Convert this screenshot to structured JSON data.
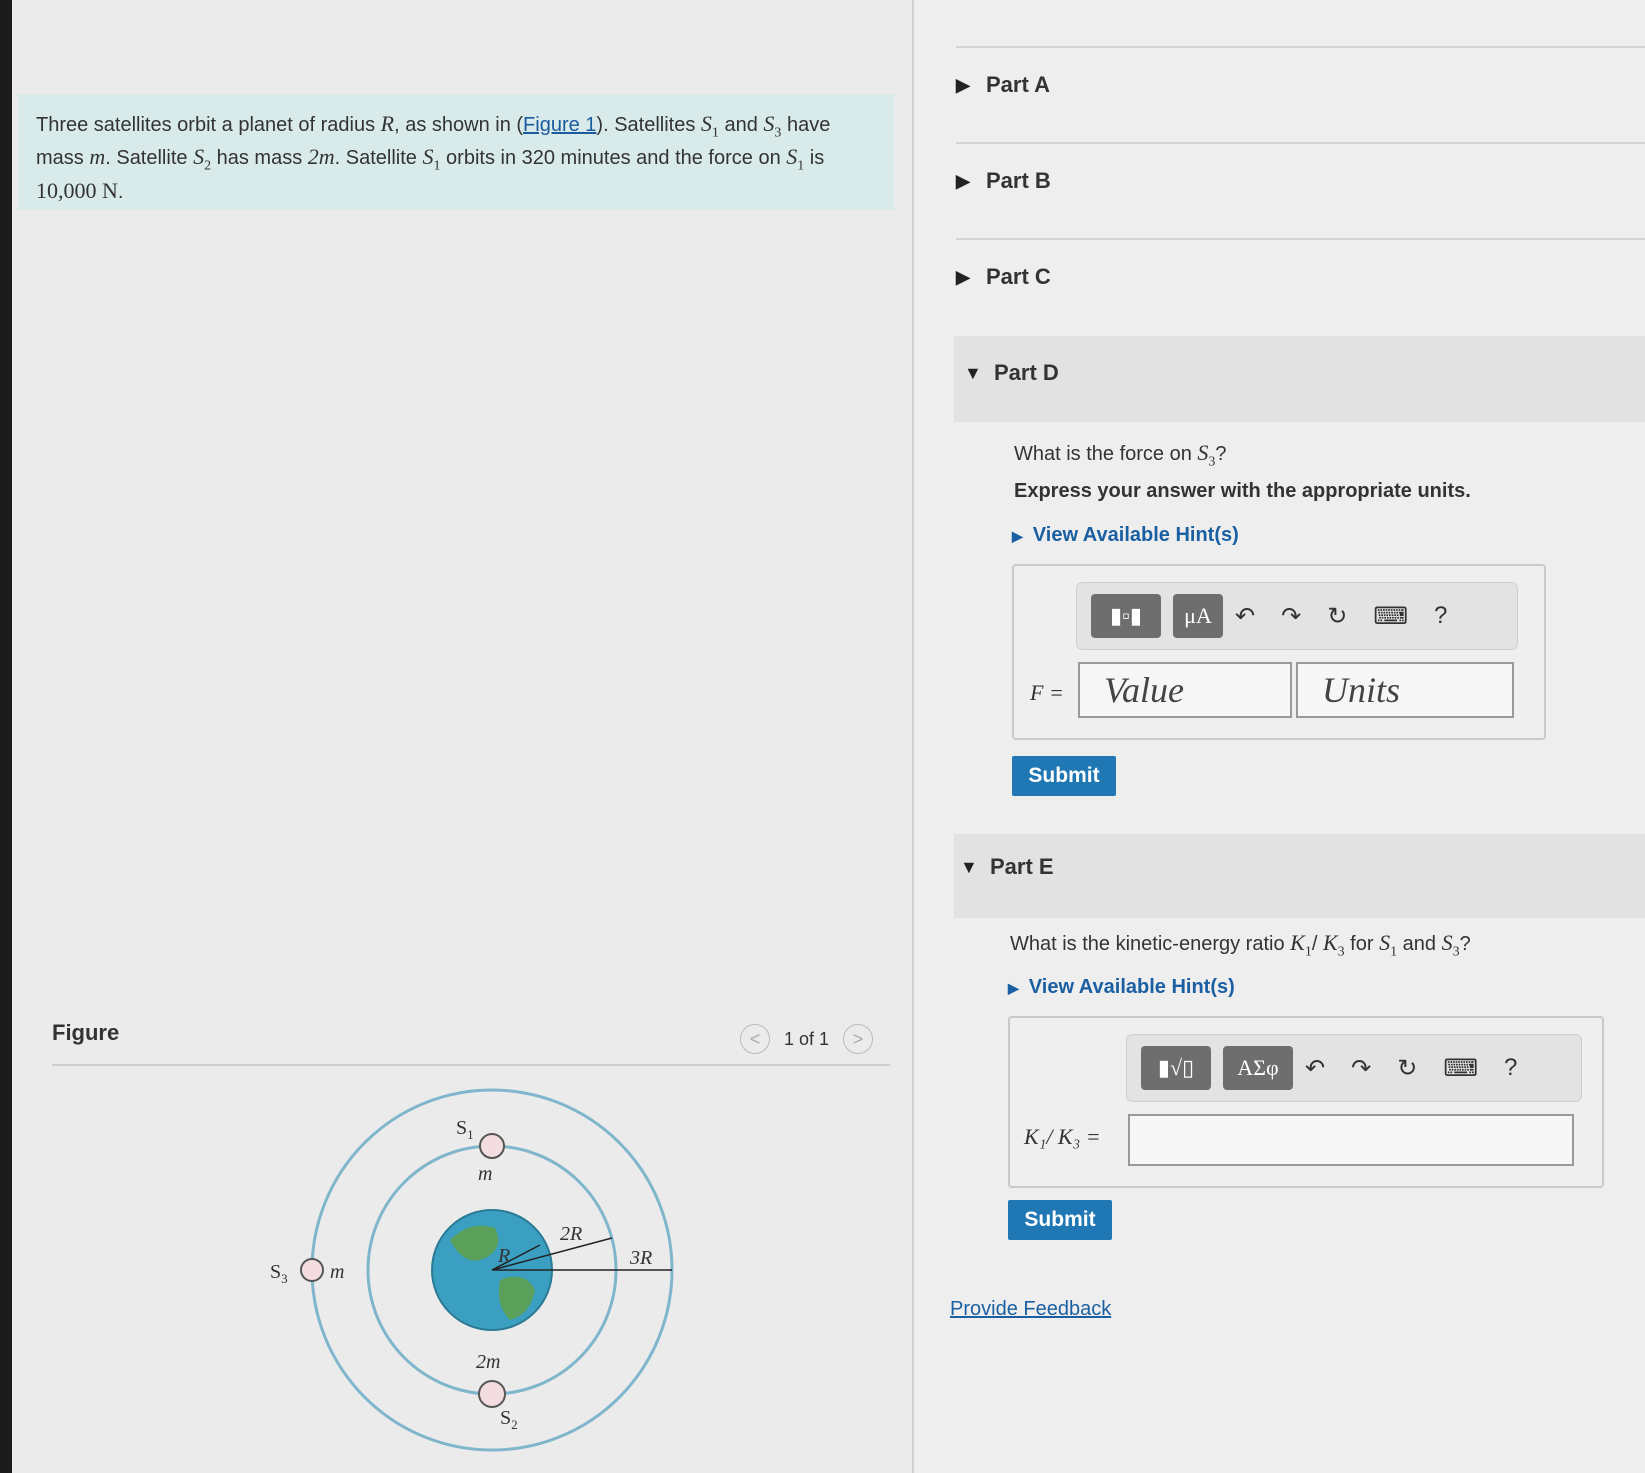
{
  "problem": {
    "t1": "Three satellites orbit a planet of radius ",
    "R": "R",
    "t2": ", as shown in (",
    "figure_link": "Figure 1",
    "t3": "). Satellites ",
    "S1": "S",
    "S1_sub": "1",
    "t4": " and ",
    "S3": "S",
    "S3_sub": "3",
    "t5": " have mass ",
    "m": "m",
    "t6": ". Satellite ",
    "S2": "S",
    "S2_sub": "2",
    "t7": " has mass ",
    "two_m": "2m",
    "t8": ". Satellite ",
    "S1b": "S",
    "S1b_sub": "1",
    "t9": " orbits in 320 minutes and the force on ",
    "S1c": "S",
    "S1c_sub": "1",
    "t10": " is ",
    "force": "10,000 N",
    "t11": "."
  },
  "figure": {
    "label": "Figure",
    "pager_text": "1 of 1",
    "prev": "<",
    "next": ">",
    "labels": {
      "s1": "S",
      "s1_sub": "1",
      "s1_mass": "m",
      "s2": "S",
      "s2_sub": "2",
      "s2_mass": "2m",
      "s3": "S",
      "s3_sub": "3",
      "s3_mass": "m",
      "r": "R",
      "r2": "2R",
      "r3": "3R"
    },
    "colors": {
      "orbit": "#7fb6cc",
      "planet_ocean": "#3a9fc0",
      "planet_land": "#5aa05a",
      "satellite_fill": "#f4dde0"
    }
  },
  "parts": {
    "a": {
      "label": "Part A",
      "caret": "▶"
    },
    "b": {
      "label": "Part B",
      "caret": "▶"
    },
    "c": {
      "label": "Part C",
      "caret": "▶"
    },
    "d": {
      "label": "Part D",
      "caret": "▼",
      "question_pre": "What is the force on ",
      "question_var": "S",
      "question_sub": "3",
      "question_post": "?",
      "instruction": "Express your answer with the appropriate units.",
      "hint": "View Available Hint(s)",
      "eq_label": "F =",
      "value_placeholder": "Value",
      "units_placeholder": "Units",
      "toolbar": {
        "b1": "▮▫▮",
        "b2": "μA",
        "undo": "↶",
        "redo": "↷",
        "reset": "↻",
        "keyboard": "⌨",
        "help": "?"
      },
      "submit": "Submit"
    },
    "e": {
      "label": "Part E",
      "caret": "▼",
      "question_pre": "What is the kinetic-energy ratio ",
      "question_k1": "K",
      "question_k1_sub": "1",
      "question_slash": "/ ",
      "question_k3": "K",
      "question_k3_sub": "3",
      "question_mid": " for ",
      "question_s1": "S",
      "question_s1_sub": "1",
      "question_and": " and ",
      "question_s3": "S",
      "question_s3_sub": "3",
      "question_post": "?",
      "hint": "View Available Hint(s)",
      "eq_label": "K₁/ K₃ =",
      "toolbar": {
        "b1": "▮√▯",
        "b2": "ΑΣφ",
        "undo": "↶",
        "redo": "↷",
        "reset": "↻",
        "keyboard": "⌨",
        "help": "?"
      },
      "submit": "Submit"
    }
  },
  "feedback": "Provide Feedback",
  "colors": {
    "accent": "#1f78b4",
    "link": "#1b5fa3",
    "problem_bg": "#d9eaea"
  }
}
